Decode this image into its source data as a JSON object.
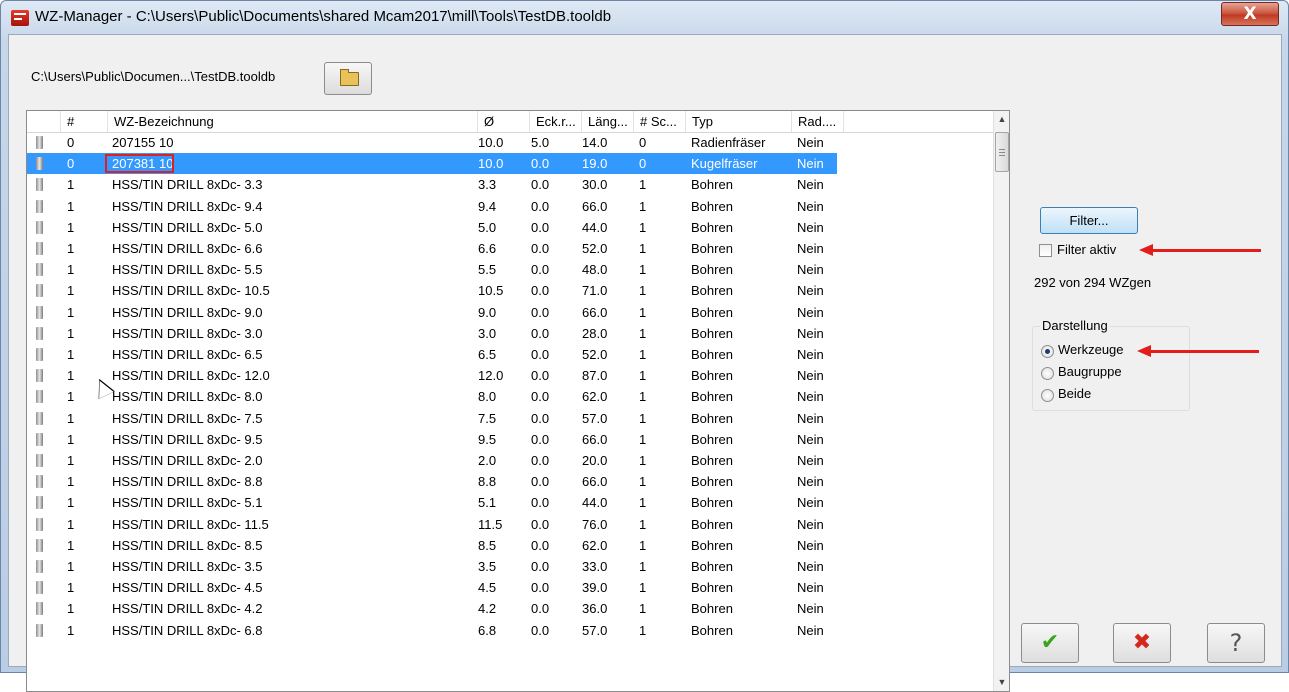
{
  "window": {
    "title": "WZ-Manager - C:\\Users\\Public\\Documents\\shared Mcam2017\\mill\\Tools\\TestDB.tooldb",
    "close_label": "X"
  },
  "path_label": "C:\\Users\\Public\\Documen...\\TestDB.tooldb",
  "columns": [
    "#",
    "WZ-Bezeichnung",
    "Ø",
    "Eck.r...",
    "Läng...",
    "# Sc...",
    "Typ",
    "Rad...."
  ],
  "rows": [
    [
      "0",
      "207155 10",
      "10.0",
      "5.0",
      "14.0",
      "0",
      "Radienfräser",
      "Nein"
    ],
    [
      "0",
      "207381 10",
      "10.0",
      "0.0",
      "19.0",
      "0",
      "Kugelfräser",
      "Nein"
    ],
    [
      "1",
      "HSS/TIN DRILL 8xDc- 3.3",
      "3.3",
      "0.0",
      "30.0",
      "1",
      "Bohren",
      "Nein"
    ],
    [
      "1",
      "HSS/TIN DRILL 8xDc- 9.4",
      "9.4",
      "0.0",
      "66.0",
      "1",
      "Bohren",
      "Nein"
    ],
    [
      "1",
      "HSS/TIN DRILL 8xDc- 5.0",
      "5.0",
      "0.0",
      "44.0",
      "1",
      "Bohren",
      "Nein"
    ],
    [
      "1",
      "HSS/TIN DRILL 8xDc- 6.6",
      "6.6",
      "0.0",
      "52.0",
      "1",
      "Bohren",
      "Nein"
    ],
    [
      "1",
      "HSS/TIN DRILL 8xDc- 5.5",
      "5.5",
      "0.0",
      "48.0",
      "1",
      "Bohren",
      "Nein"
    ],
    [
      "1",
      "HSS/TIN DRILL 8xDc- 10.5",
      "10.5",
      "0.0",
      "71.0",
      "1",
      "Bohren",
      "Nein"
    ],
    [
      "1",
      "HSS/TIN DRILL 8xDc- 9.0",
      "9.0",
      "0.0",
      "66.0",
      "1",
      "Bohren",
      "Nein"
    ],
    [
      "1",
      "HSS/TIN DRILL 8xDc- 3.0",
      "3.0",
      "0.0",
      "28.0",
      "1",
      "Bohren",
      "Nein"
    ],
    [
      "1",
      "HSS/TIN DRILL 8xDc- 6.5",
      "6.5",
      "0.0",
      "52.0",
      "1",
      "Bohren",
      "Nein"
    ],
    [
      "1",
      "HSS/TIN DRILL 8xDc- 12.0",
      "12.0",
      "0.0",
      "87.0",
      "1",
      "Bohren",
      "Nein"
    ],
    [
      "1",
      "HSS/TIN DRILL 8xDc- 8.0",
      "8.0",
      "0.0",
      "62.0",
      "1",
      "Bohren",
      "Nein"
    ],
    [
      "1",
      "HSS/TIN DRILL 8xDc- 7.5",
      "7.5",
      "0.0",
      "57.0",
      "1",
      "Bohren",
      "Nein"
    ],
    [
      "1",
      "HSS/TIN DRILL 8xDc- 9.5",
      "9.5",
      "0.0",
      "66.0",
      "1",
      "Bohren",
      "Nein"
    ],
    [
      "1",
      "HSS/TIN DRILL 8xDc- 2.0",
      "2.0",
      "0.0",
      "20.0",
      "1",
      "Bohren",
      "Nein"
    ],
    [
      "1",
      "HSS/TIN DRILL 8xDc- 8.8",
      "8.8",
      "0.0",
      "66.0",
      "1",
      "Bohren",
      "Nein"
    ],
    [
      "1",
      "HSS/TIN DRILL 8xDc- 5.1",
      "5.1",
      "0.0",
      "44.0",
      "1",
      "Bohren",
      "Nein"
    ],
    [
      "1",
      "HSS/TIN DRILL 8xDc- 11.5",
      "11.5",
      "0.0",
      "76.0",
      "1",
      "Bohren",
      "Nein"
    ],
    [
      "1",
      "HSS/TIN DRILL 8xDc- 8.5",
      "8.5",
      "0.0",
      "62.0",
      "1",
      "Bohren",
      "Nein"
    ],
    [
      "1",
      "HSS/TIN DRILL 8xDc- 3.5",
      "3.5",
      "0.0",
      "33.0",
      "1",
      "Bohren",
      "Nein"
    ],
    [
      "1",
      "HSS/TIN DRILL 8xDc- 4.5",
      "4.5",
      "0.0",
      "39.0",
      "1",
      "Bohren",
      "Nein"
    ],
    [
      "1",
      "HSS/TIN DRILL 8xDc- 4.2",
      "4.2",
      "0.0",
      "36.0",
      "1",
      "Bohren",
      "Nein"
    ],
    [
      "1",
      "HSS/TIN DRILL 8xDc- 6.8",
      "6.8",
      "0.0",
      "57.0",
      "1",
      "Bohren",
      "Nein"
    ]
  ],
  "selected_row": 1,
  "filter": {
    "button_label": "Filter...",
    "active_label": "Filter aktiv",
    "active": false
  },
  "count_label": "292 von 294 WZgen",
  "darstellung": {
    "legend": "Darstellung",
    "options": [
      "Werkzeuge",
      "Baugruppe",
      "Beide"
    ],
    "selected": 0
  },
  "buttons": {
    "ok_icon": "check-icon",
    "cancel_icon": "x-icon",
    "help_icon": "question-icon"
  },
  "colors": {
    "selection": "#3399ff",
    "highlight_box": "#e02020",
    "annotation_arrow": "#e31c1c"
  }
}
